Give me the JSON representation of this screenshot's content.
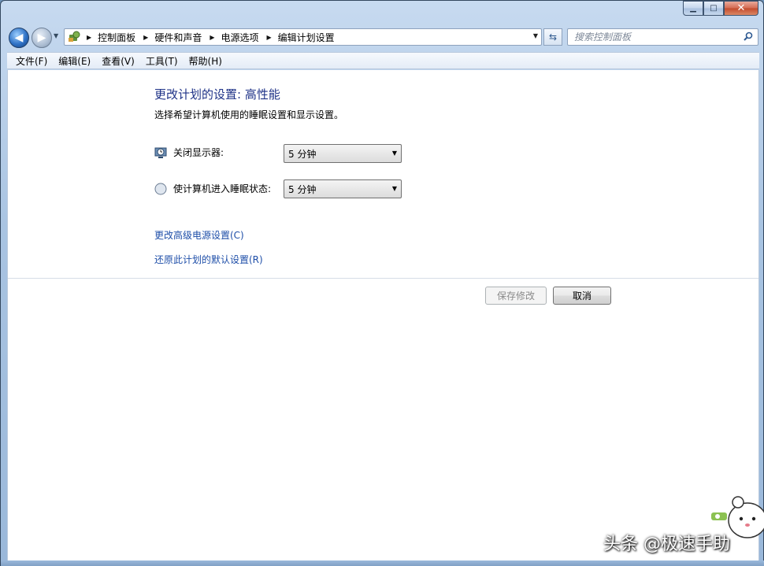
{
  "window": {
    "minimize_glyph": "▁",
    "maximize_glyph": "□",
    "close_glyph": "✕"
  },
  "breadcrumb": [
    "控制面板",
    "硬件和声音",
    "电源选项",
    "编辑计划设置"
  ],
  "search": {
    "placeholder": "搜索控制面板"
  },
  "menu": [
    "文件(F)",
    "编辑(E)",
    "查看(V)",
    "工具(T)",
    "帮助(H)"
  ],
  "main": {
    "title": "更改计划的设置: 高性能",
    "subtitle": "选择希望计算机使用的睡眠设置和显示设置。",
    "settings": [
      {
        "label": "关闭显示器:",
        "value": "5 分钟",
        "icon": "monitor-clock-icon"
      },
      {
        "label": "使计算机进入睡眠状态:",
        "value": "5 分钟",
        "icon": "moon-icon"
      }
    ],
    "links": [
      "更改高级电源设置(C)",
      "还原此计划的默认设置(R)"
    ],
    "buttons": {
      "save": "保存修改",
      "cancel": "取消"
    }
  },
  "watermark": "头条 @极速手助",
  "colors": {
    "heading": "#1e3287",
    "link": "#1e4ea8"
  }
}
